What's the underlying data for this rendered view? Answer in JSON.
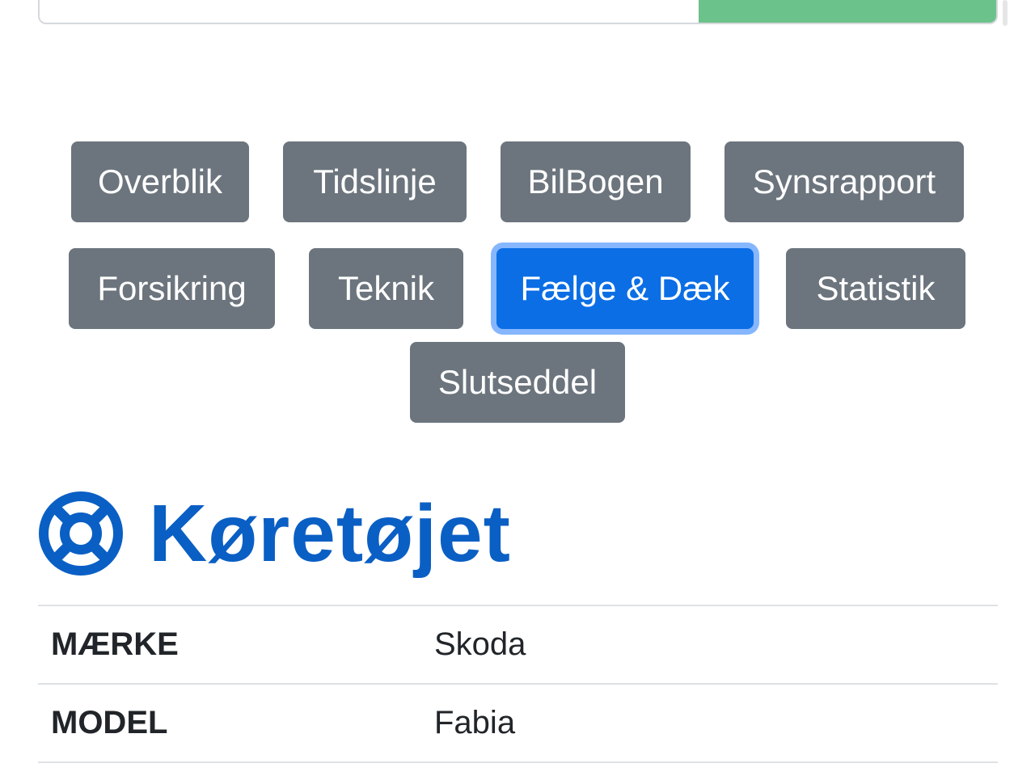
{
  "search": {
    "value": "",
    "colors": {
      "button": "#6cc28b"
    }
  },
  "nav": {
    "items": [
      {
        "label": "Overblik",
        "active": false
      },
      {
        "label": "Tidslinje",
        "active": false
      },
      {
        "label": "BilBogen",
        "active": false
      },
      {
        "label": "Synsrapport",
        "active": false
      },
      {
        "label": "Forsikring",
        "active": false
      },
      {
        "label": "Teknik",
        "active": false
      },
      {
        "label": "Fælge & Dæk",
        "active": true
      },
      {
        "label": "Statistik",
        "active": false
      },
      {
        "label": "Slutseddel",
        "active": false
      }
    ],
    "colors": {
      "default": "#6c757d",
      "active": "#0b6ee5"
    }
  },
  "section": {
    "title": "Køretøjet",
    "icon": "lifebuoy-icon",
    "color": "#0a5fc4"
  },
  "vehicle": {
    "rows": [
      {
        "key": "MÆRKE",
        "value": "Skoda"
      },
      {
        "key": "MODEL",
        "value": "Fabia"
      }
    ]
  }
}
